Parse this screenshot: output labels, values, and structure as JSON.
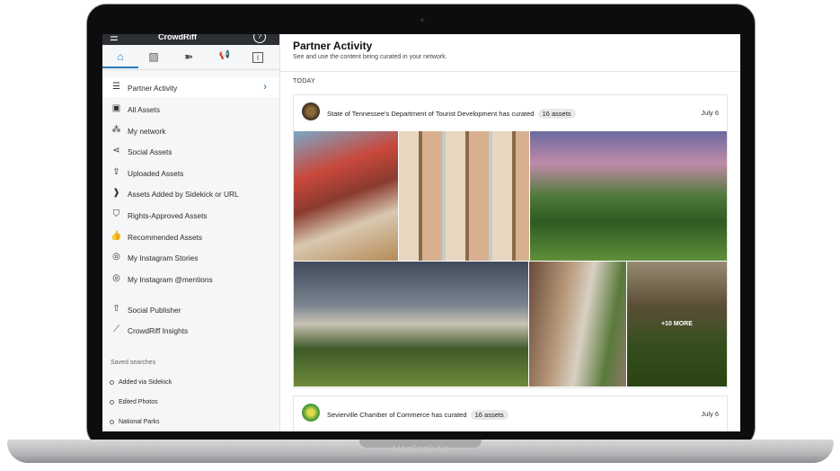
{
  "device": {
    "brand": "MacBook Air"
  },
  "topbar": {
    "menu_icon": "hamburger-icon",
    "logo": "CrowdRiff",
    "help": "?"
  },
  "tabs": [
    {
      "name": "home",
      "icon": "⌂"
    },
    {
      "name": "gallery",
      "icon": "▨"
    },
    {
      "name": "sidekick",
      "icon": "➽"
    },
    {
      "name": "announcements",
      "icon": "📢"
    },
    {
      "name": "info",
      "icon": "i"
    }
  ],
  "nav": [
    {
      "label": "Partner Activity",
      "icon": "☰",
      "icon_name": "partner-activity-icon",
      "active": true
    },
    {
      "label": "All Assets",
      "icon": "▣",
      "icon_name": "all-assets-icon"
    },
    {
      "label": "My network",
      "icon": "⁂",
      "icon_name": "network-icon"
    },
    {
      "label": "Social Assets",
      "icon": "⋖",
      "icon_name": "share-icon"
    },
    {
      "label": "Uploaded Assets",
      "icon": "⇪",
      "icon_name": "upload-icon"
    },
    {
      "label": "Assets Added by Sidekick or URL",
      "icon": "❱",
      "icon_name": "sidekick-icon"
    },
    {
      "label": "Rights-Approved Assets",
      "icon": "⛉",
      "icon_name": "shield-icon"
    },
    {
      "label": "Recommended Assets",
      "icon": "👍",
      "icon_name": "thumbs-up-icon"
    },
    {
      "label": "My Instagram Stories",
      "icon": "◎",
      "icon_name": "instagram-icon"
    },
    {
      "label": "My Instagram @mentions",
      "icon": "◎",
      "icon_name": "instagram-icon"
    },
    {
      "label": "Social Publisher",
      "icon": "⇧",
      "icon_name": "publish-icon"
    },
    {
      "label": "CrowdRiff Insights",
      "icon": "⟋",
      "icon_name": "insights-icon"
    }
  ],
  "saved_searches": {
    "title": "Saved searches",
    "items": [
      "Added via Sidekick",
      "Edited Photos",
      "National Parks"
    ]
  },
  "page": {
    "title": "Partner Activity",
    "subtitle": "See and use the content being curated in your network.",
    "section": "TODAY"
  },
  "cards": [
    {
      "partner": "State of Tennessee's Department of Tourist Development",
      "action": "has curated",
      "count": "16 assets",
      "date": "July 6",
      "more_label": "+10 MORE"
    },
    {
      "partner": "Sevierville Chamber of Commerce",
      "action": "has curated",
      "count": "16 assets",
      "date": "July 6"
    }
  ],
  "colors": {
    "accent": "#2a7ab8",
    "topbar": "#2c2f33"
  }
}
